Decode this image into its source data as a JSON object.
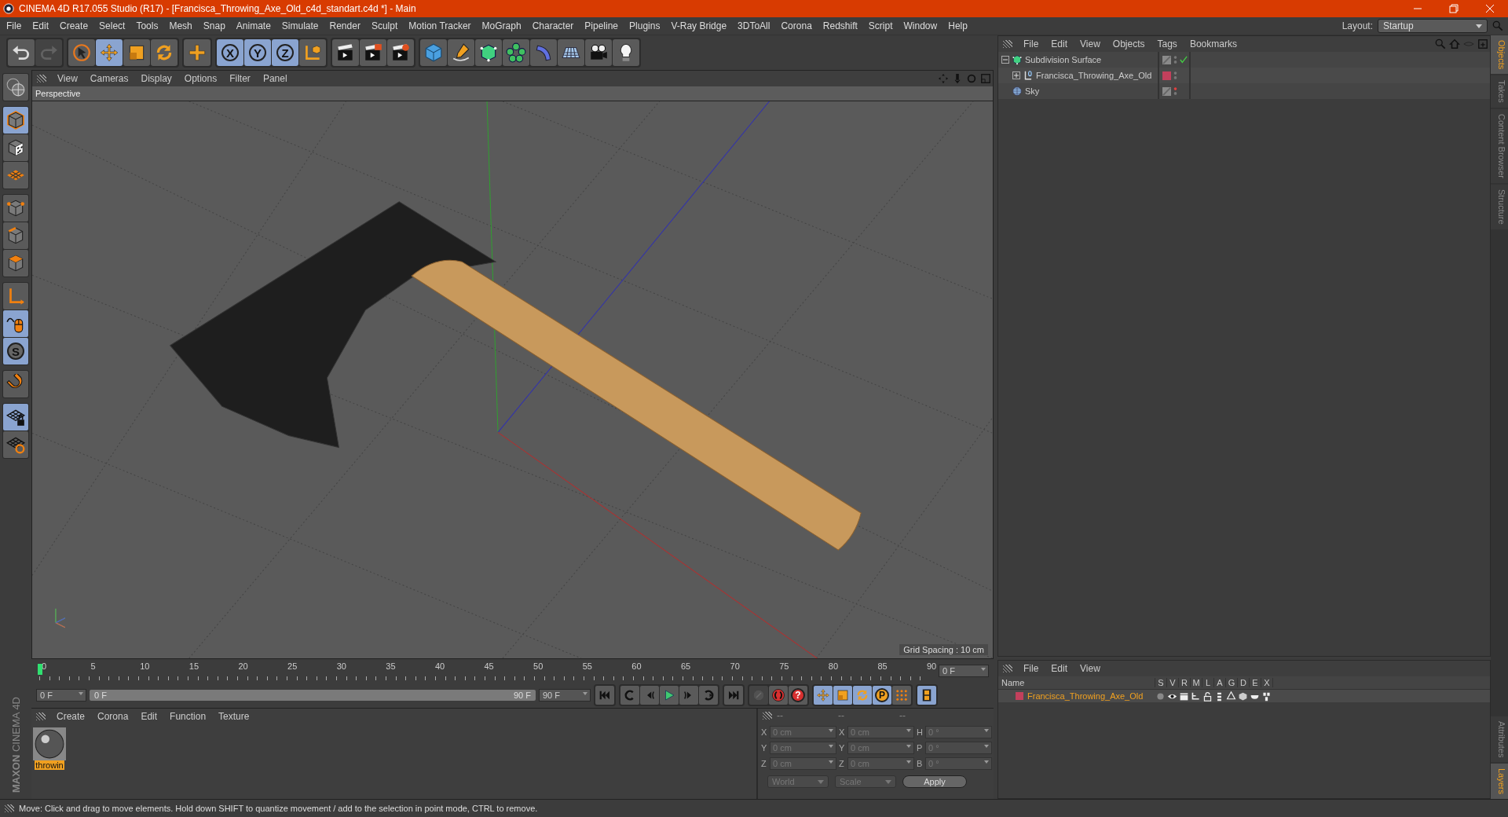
{
  "window": {
    "title": "CINEMA 4D R17.055 Studio (R17) - [Francisca_Throwing_Axe_Old_c4d_standart.c4d *] - Main"
  },
  "menu": [
    "File",
    "Edit",
    "Create",
    "Select",
    "Tools",
    "Mesh",
    "Snap",
    "Animate",
    "Simulate",
    "Render",
    "Sculpt",
    "Motion Tracker",
    "MoGraph",
    "Character",
    "Pipeline",
    "Plugins",
    "V-Ray Bridge",
    "3DToAll",
    "Corona",
    "Redshift",
    "Script",
    "Window",
    "Help"
  ],
  "layout": {
    "label": "Layout:",
    "value": "Startup"
  },
  "toolbar": [
    {
      "items": [
        {
          "kind": "undo",
          "selected": false,
          "disabled": false
        },
        {
          "kind": "redo",
          "selected": false,
          "disabled": true
        }
      ]
    },
    {
      "items": [
        {
          "kind": "select",
          "selected": false,
          "disabled": false
        },
        {
          "kind": "move",
          "selected": true,
          "disabled": false
        },
        {
          "kind": "scale",
          "selected": false,
          "disabled": false
        },
        {
          "kind": "rotate",
          "selected": false,
          "disabled": false
        }
      ]
    },
    {
      "items": [
        {
          "kind": "transform",
          "selected": false,
          "disabled": false
        }
      ]
    },
    {
      "items": [
        {
          "kind": "axis-lock",
          "label": "X",
          "selected": true,
          "disabled": false
        },
        {
          "kind": "axis-lock",
          "label": "Y",
          "selected": true,
          "disabled": false
        },
        {
          "kind": "axis-lock",
          "label": "Z",
          "selected": true,
          "disabled": false
        },
        {
          "kind": "coord",
          "selected": false,
          "disabled": false
        }
      ]
    },
    {
      "items": [
        {
          "kind": "render-view",
          "selected": false,
          "disabled": false
        },
        {
          "kind": "render",
          "selected": false,
          "disabled": false
        },
        {
          "kind": "render-settings",
          "selected": false,
          "disabled": false
        }
      ]
    },
    {
      "items": [
        {
          "kind": "cube",
          "selected": false,
          "disabled": false
        },
        {
          "kind": "pen",
          "selected": false,
          "disabled": false
        },
        {
          "kind": "subdivision",
          "selected": false,
          "disabled": false
        },
        {
          "kind": "cloner",
          "selected": false,
          "disabled": false
        },
        {
          "kind": "deformer",
          "selected": false,
          "disabled": false
        },
        {
          "kind": "floor",
          "selected": false,
          "disabled": false
        },
        {
          "kind": "camera",
          "selected": false,
          "disabled": false
        },
        {
          "kind": "light",
          "selected": false,
          "disabled": false
        }
      ]
    }
  ],
  "left_toolbar": [
    {
      "items": [
        {
          "kind": "make-editable",
          "selected": false
        }
      ]
    },
    {
      "items": [
        {
          "kind": "model",
          "selected": true
        },
        {
          "kind": "texture",
          "selected": false
        },
        {
          "kind": "workplane",
          "selected": false
        }
      ]
    },
    {
      "items": [
        {
          "kind": "points",
          "selected": false
        },
        {
          "kind": "edges",
          "selected": false
        },
        {
          "kind": "polygons",
          "selected": false
        }
      ]
    },
    {
      "items": [
        {
          "kind": "axis",
          "selected": false
        },
        {
          "kind": "tweak",
          "selected": true
        },
        {
          "kind": "snap",
          "label": "S",
          "selected": true
        }
      ]
    },
    {
      "items": [
        {
          "kind": "magnet",
          "selected": false
        }
      ]
    },
    {
      "items": [
        {
          "kind": "grid-lock",
          "selected": true
        },
        {
          "kind": "grid-rotate",
          "selected": false
        }
      ]
    }
  ],
  "viewport": {
    "menu": [
      "View",
      "Cameras",
      "Display",
      "Options",
      "Filter",
      "Panel"
    ],
    "camera": "Perspective",
    "grid_label": "Grid Spacing : 10 cm"
  },
  "timeline": {
    "ticks": [
      "0",
      "5",
      "10",
      "15",
      "20",
      "25",
      "30",
      "35",
      "40",
      "45",
      "50",
      "55",
      "60",
      "65",
      "70",
      "75",
      "80",
      "85",
      "90"
    ],
    "current_frame": "0 F",
    "start": "0 F",
    "preview_range": {
      "start": "0 F",
      "end": "90 F"
    },
    "end": "90 F"
  },
  "transport": [
    {
      "items": [
        {
          "kind": "go-start",
          "selected": false,
          "disabled": false
        }
      ]
    },
    {
      "items": [
        {
          "kind": "prev-key",
          "selected": false,
          "disabled": false
        },
        {
          "kind": "prev-frame",
          "selected": false,
          "disabled": false
        },
        {
          "kind": "play",
          "selected": false,
          "disabled": false
        },
        {
          "kind": "next-frame",
          "selected": false,
          "disabled": false
        },
        {
          "kind": "next-key",
          "selected": false,
          "disabled": false
        }
      ]
    },
    {
      "items": [
        {
          "kind": "go-end",
          "selected": false,
          "disabled": false
        }
      ]
    },
    {
      "items": [
        {
          "kind": "keyframe",
          "selected": false,
          "disabled": true
        },
        {
          "kind": "record",
          "selected": false,
          "disabled": false
        },
        {
          "kind": "autokey",
          "label": "?",
          "selected": false,
          "disabled": false
        }
      ]
    },
    {
      "items": [
        {
          "kind": "move",
          "selected": true,
          "disabled": false
        },
        {
          "kind": "scale",
          "selected": true,
          "disabled": false
        },
        {
          "kind": "rotate",
          "selected": true,
          "disabled": false
        },
        {
          "kind": "param",
          "label": "P",
          "selected": true,
          "disabled": false
        },
        {
          "kind": "dots",
          "selected": false,
          "disabled": false
        }
      ]
    },
    {
      "items": [
        {
          "kind": "film",
          "selected": true,
          "disabled": false
        }
      ]
    }
  ],
  "materials": {
    "menu": [
      "Create",
      "Corona",
      "Edit",
      "Function",
      "Texture"
    ],
    "items": [
      {
        "name": "throwin",
        "selected": true
      }
    ]
  },
  "coordinates": {
    "headers": [
      "--",
      "--",
      "--"
    ],
    "rows": [
      {
        "fields": [
          {
            "axis": "X",
            "value": "0 cm"
          },
          {
            "axis": "X",
            "value": "0 cm"
          },
          {
            "axis": "H",
            "value": "0 °"
          }
        ]
      },
      {
        "fields": [
          {
            "axis": "Y",
            "value": "0 cm"
          },
          {
            "axis": "Y",
            "value": "0 cm"
          },
          {
            "axis": "P",
            "value": "0 °"
          }
        ]
      },
      {
        "fields": [
          {
            "axis": "Z",
            "value": "0 cm"
          },
          {
            "axis": "Z",
            "value": "0 cm"
          },
          {
            "axis": "B",
            "value": "0 °"
          }
        ]
      }
    ],
    "mode": "World",
    "transform": "Scale",
    "apply": "Apply",
    "disabled": true
  },
  "objects": {
    "menu": [
      "File",
      "Edit",
      "View",
      "Objects",
      "Tags",
      "Bookmarks"
    ],
    "tree": [
      {
        "name": "Subdivision Surface",
        "kind": "subdivision",
        "expanded": true,
        "enabled": true,
        "hidden_in_editor": false,
        "children": [
          {
            "name": "Francisca_Throwing_Axe_Old",
            "kind": "null",
            "expanded": false,
            "color": "#c2405c",
            "hidden_in_editor": false
          }
        ]
      },
      {
        "name": "Sky",
        "kind": "sky",
        "hidden_in_editor": true
      }
    ]
  },
  "layers": {
    "menu": [
      "File",
      "Edit",
      "View"
    ],
    "columns": [
      "Name",
      "S",
      "V",
      "R",
      "M",
      "L",
      "A",
      "G",
      "D",
      "E",
      "X"
    ],
    "rows": [
      {
        "name": "Francisca_Throwing_Axe_Old",
        "color": "#c2405c"
      }
    ]
  },
  "side_tabs_top": [
    {
      "label": "Objects",
      "selected": true
    },
    {
      "label": "Takes",
      "selected": false
    },
    {
      "label": "Content Browser",
      "selected": false
    },
    {
      "label": "Structure",
      "selected": false
    }
  ],
  "side_tabs_bottom": [
    {
      "label": "Attributes",
      "selected": false
    },
    {
      "label": "Layers",
      "selected": true
    }
  ],
  "logo": {
    "line1": "MAXON",
    "line2": "CINEMA 4D"
  },
  "status_bar": "Move: Click and drag to move elements. Hold down SHIFT to quantize movement / add to the selection in point mode, CTRL to remove."
}
